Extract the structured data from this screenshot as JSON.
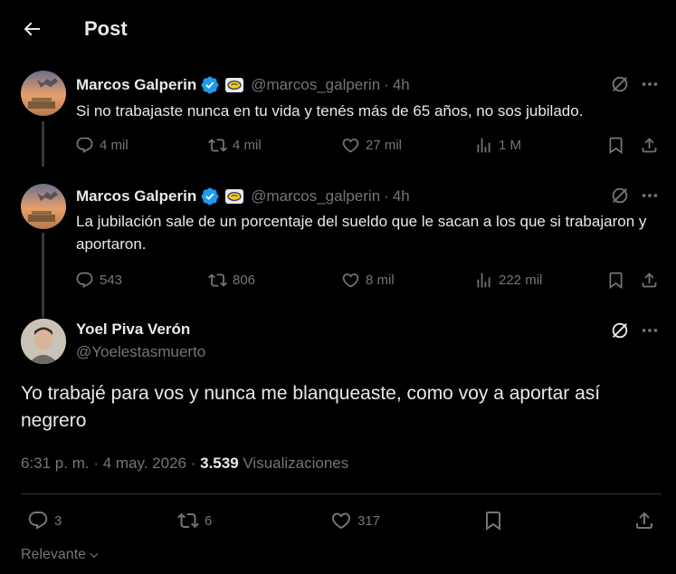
{
  "header": {
    "title": "Post"
  },
  "thread": [
    {
      "name": "Marcos Galperin",
      "handle": "@marcos_galperin",
      "dot": "·",
      "time": "4h",
      "text": "Si no trabajaste nunca en tu vida y tenés más de 65 años, no sos jubilado.",
      "replies": "4 mil",
      "reposts": "4 mil",
      "likes": "27 mil",
      "views": "1 M"
    },
    {
      "name": "Marcos Galperin",
      "handle": "@marcos_galperin",
      "dot": "·",
      "time": "4h",
      "text": "La jubilación sale de un porcentaje del sueldo que le sacan a los que si trabajaron y aportaron.",
      "replies": "543",
      "reposts": "806",
      "likes": "8 mil",
      "views": "222 mil"
    }
  ],
  "main": {
    "name": "Yoel Piva Verón",
    "handle": "@Yoelestasmuerto",
    "text": "Yo trabajé para vos y nunca me blanqueaste, como voy a aportar así negrero",
    "date": "6:31 p. m. · 4 may. 2026 · ",
    "views_count": "3.539",
    "views_label": " Visualizaciones",
    "replies": "3",
    "reposts": "6",
    "likes": "317"
  },
  "sort": {
    "label": "Relevante"
  },
  "colors": {
    "background": "#000000",
    "text": "#e7e9ea",
    "muted": "#71767b",
    "verified": "#1d9bf0",
    "divider": "#2f3336"
  }
}
